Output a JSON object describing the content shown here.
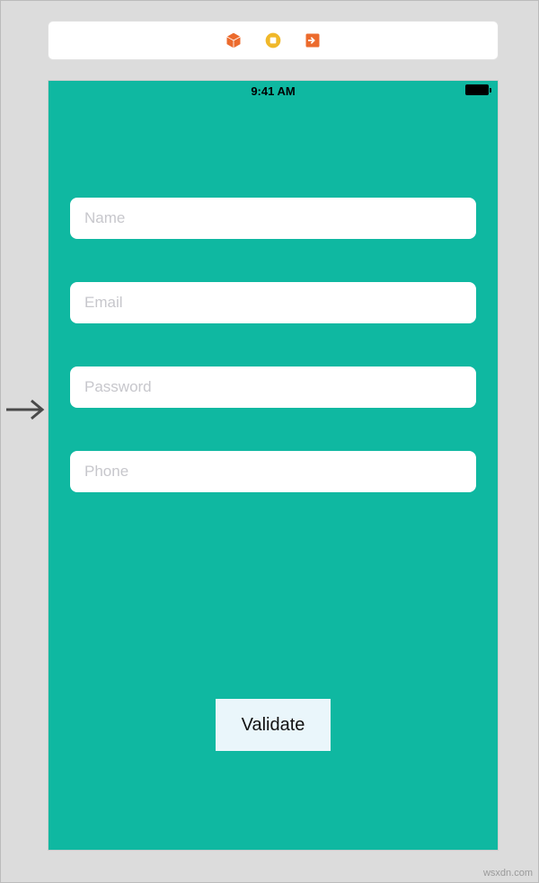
{
  "status_bar": {
    "time": "9:41 AM"
  },
  "toolbar": {
    "icons": [
      "cube-icon",
      "stop-icon",
      "exit-icon"
    ]
  },
  "form": {
    "name": {
      "placeholder": "Name",
      "value": ""
    },
    "email": {
      "placeholder": "Email",
      "value": ""
    },
    "password": {
      "placeholder": "Password",
      "value": ""
    },
    "phone": {
      "placeholder": "Phone",
      "value": ""
    }
  },
  "validate_button_label": "Validate",
  "watermark": "wsxdn.com",
  "colors": {
    "app_background": "#0fb8a1",
    "toolbar_orange": "#ec6b2d",
    "toolbar_yellow": "#f0b82a",
    "button_bg": "#eaf6fb"
  }
}
